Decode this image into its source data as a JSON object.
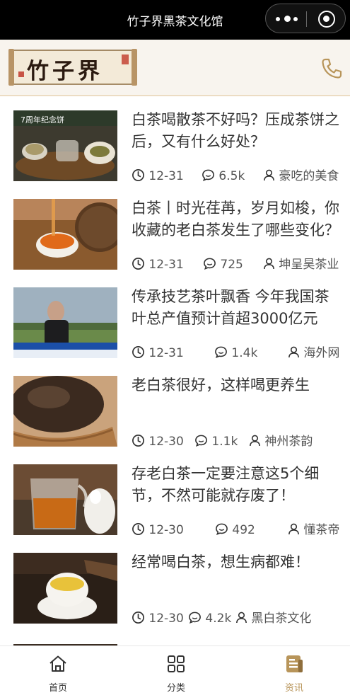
{
  "titlebar": {
    "title": "竹子界黑茶文化馆"
  },
  "brand": {
    "logo_text": "竹子界",
    "logo_icon": "calligraphy-logo-icon",
    "phone_icon": "phone-icon"
  },
  "articles": [
    {
      "title": "白茶喝散茶不好吗？压成茶饼之后，又有什么好处？",
      "date": "12-31",
      "comments": "6.5k",
      "author": "豪吃的美食",
      "thumb_caption": "7周年纪念饼"
    },
    {
      "title": "白茶丨时光荏苒，岁月如梭，你收藏的老白茶发生了哪些变化？",
      "date": "12-31",
      "comments": "725",
      "author": "坤呈昊茶业"
    },
    {
      "title": "传承技艺茶叶飘香 今年我国茶叶总产值预计首超3000亿元",
      "date": "12-31",
      "comments": "1.4k",
      "author": "海外网"
    },
    {
      "title": "老白茶很好，这样喝更养生",
      "date": "12-30",
      "comments": "1.1k",
      "author": "神州茶韵"
    },
    {
      "title": "存老白茶一定要注意这5个细节，不然可能就存废了！",
      "date": "12-30",
      "comments": "492",
      "author": "懂茶帝"
    },
    {
      "title": "经常喝白茶，想生病都难！",
      "date": "12-30",
      "comments": "4.2k",
      "author": "黑白茶文化"
    }
  ],
  "tabbar": {
    "tabs": [
      {
        "label": "首页",
        "icon": "home-icon"
      },
      {
        "label": "分类",
        "icon": "grid-icon"
      },
      {
        "label": "资讯",
        "icon": "news-icon"
      }
    ],
    "active_index": 2,
    "active_color": "#b8955a"
  },
  "colors": {
    "accent": "#b8955a",
    "header_bg": "#f8f4ee"
  }
}
